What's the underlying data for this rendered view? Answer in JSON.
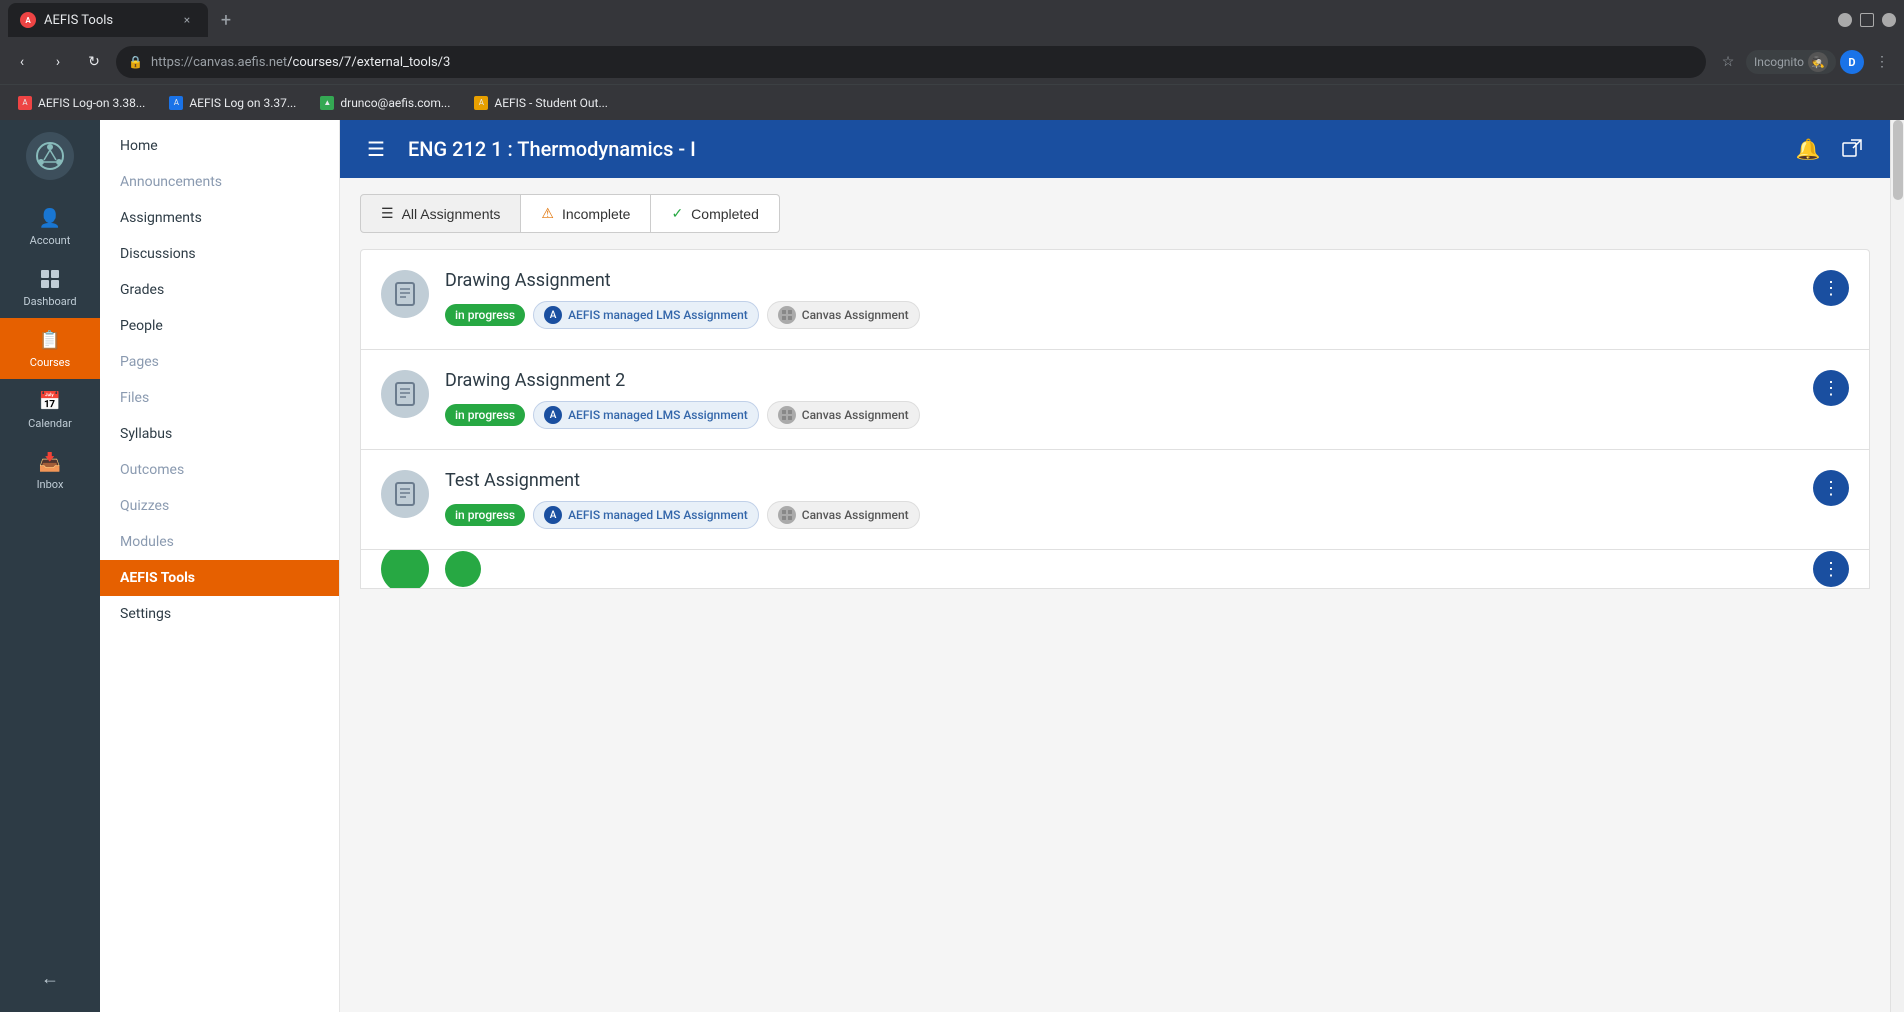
{
  "browser": {
    "tab_title": "AEFIS Tools",
    "tab_close": "×",
    "tab_new": "+",
    "url_base": "https://canvas.aefis.net",
    "url_path": "/courses/7/external_tools/3",
    "nav_back": "‹",
    "nav_forward": "›",
    "nav_refresh": "↻",
    "incognito_label": "Incognito",
    "bookmarks": [
      {
        "label": "AEFIS Log-on 3.38...",
        "color": "#e44"
      },
      {
        "label": "AEFIS Log on 3.37...",
        "color": "#1a73e8"
      },
      {
        "label": "drunco@aefis.com...",
        "color": "#34a853"
      },
      {
        "label": "AEFIS - Student Out...",
        "color": "#e8a000"
      }
    ]
  },
  "nav_rail": {
    "items": [
      {
        "id": "account",
        "label": "Account",
        "icon": "👤"
      },
      {
        "id": "dashboard",
        "label": "Dashboard",
        "icon": "⊞"
      },
      {
        "id": "courses",
        "label": "Courses",
        "icon": "📋",
        "active": true
      },
      {
        "id": "calendar",
        "label": "Calendar",
        "icon": "📅"
      },
      {
        "id": "inbox",
        "label": "Inbox",
        "icon": "📥"
      }
    ],
    "collapse_label": "←"
  },
  "sidebar": {
    "items": [
      {
        "id": "home",
        "label": "Home",
        "active": false
      },
      {
        "id": "announcements",
        "label": "Announcements",
        "dim": true
      },
      {
        "id": "assignments",
        "label": "Assignments",
        "active": false
      },
      {
        "id": "discussions",
        "label": "Discussions",
        "active": false
      },
      {
        "id": "grades",
        "label": "Grades",
        "active": false
      },
      {
        "id": "people",
        "label": "People",
        "active": false
      },
      {
        "id": "pages",
        "label": "Pages",
        "dim": true
      },
      {
        "id": "files",
        "label": "Files",
        "dim": true
      },
      {
        "id": "syllabus",
        "label": "Syllabus",
        "active": false
      },
      {
        "id": "outcomes",
        "label": "Outcomes",
        "dim": true
      },
      {
        "id": "quizzes",
        "label": "Quizzes",
        "dim": true
      },
      {
        "id": "modules",
        "label": "Modules",
        "dim": true
      },
      {
        "id": "aefis-tools",
        "label": "AEFIS Tools",
        "active": true
      },
      {
        "id": "settings",
        "label": "Settings",
        "active": false
      }
    ]
  },
  "header": {
    "title": "ENG 212 1 : Thermodynamics - I",
    "menu_icon": "☰",
    "bell_icon": "🔔",
    "external_icon": "⬡"
  },
  "filter_tabs": [
    {
      "id": "all",
      "label": "All Assignments",
      "icon": "☰",
      "active": true
    },
    {
      "id": "incomplete",
      "label": "Incomplete",
      "icon": "⚠",
      "active": false
    },
    {
      "id": "completed",
      "label": "Completed",
      "icon": "✓",
      "active": false
    }
  ],
  "assignments": [
    {
      "id": 1,
      "title": "Drawing Assignment",
      "status": "in progress",
      "aefis_label": "AEFIS managed LMS Assignment",
      "canvas_label": "Canvas Assignment"
    },
    {
      "id": 2,
      "title": "Drawing Assignment 2",
      "status": "in progress",
      "aefis_label": "AEFIS managed LMS Assignment",
      "canvas_label": "Canvas Assignment"
    },
    {
      "id": 3,
      "title": "Test Assignment",
      "status": "in progress",
      "aefis_label": "AEFIS managed LMS Assignment",
      "canvas_label": "Canvas Assignment"
    }
  ],
  "colors": {
    "nav_bg": "#2d3b45",
    "header_bg": "#1a4fa0",
    "active_sidebar": "#e66000",
    "in_progress": "#27a843",
    "menu_btn": "#1a4fa0"
  }
}
